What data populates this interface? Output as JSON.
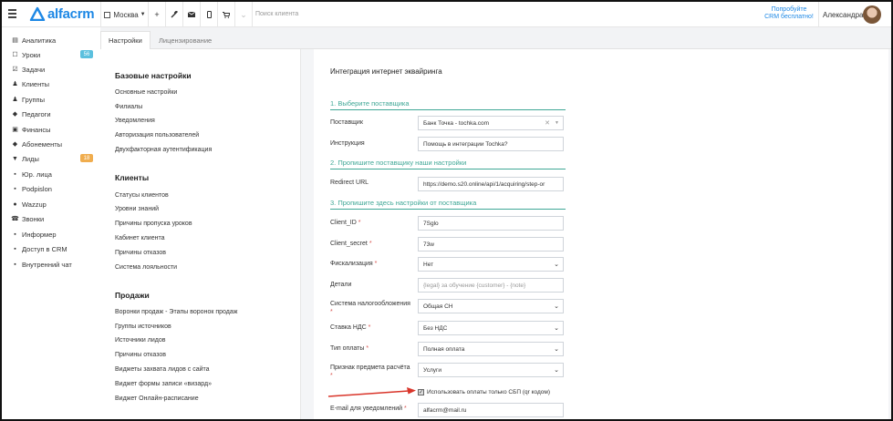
{
  "topbar": {
    "brand": "alfacrm",
    "city": "Москва",
    "search_placeholder": "Поиск клиента",
    "promo_line1": "Попробуйте",
    "promo_line2": "CRM бесплатно!",
    "username": "Александра",
    "icons": [
      "plus-icon",
      "wrench-icon",
      "mail-icon",
      "phone-icon",
      "cart-icon",
      "chevron-down-icon"
    ]
  },
  "sidebar": {
    "items": [
      {
        "label": "Аналитика",
        "icon": "analytics-icon",
        "glyph": "▤"
      },
      {
        "label": "Уроки",
        "icon": "calendar-icon",
        "glyph": "☐",
        "badge": "56"
      },
      {
        "label": "Задачи",
        "icon": "tasks-icon",
        "glyph": "☑"
      },
      {
        "label": "Клиенты",
        "icon": "user-icon",
        "glyph": "👤"
      },
      {
        "label": "Группы",
        "icon": "users-icon",
        "glyph": "👥"
      },
      {
        "label": "Педагоги",
        "icon": "graduation-icon",
        "glyph": "🎓"
      },
      {
        "label": "Финансы",
        "icon": "money-icon",
        "glyph": "▣"
      },
      {
        "label": "Абонементы",
        "icon": "tag-icon",
        "glyph": "◆"
      },
      {
        "label": "Лиды",
        "icon": "funnel-icon",
        "glyph": "⚲",
        "badge": "18"
      },
      {
        "label": "Юр. лица",
        "icon": "briefcase-icon",
        "glyph": "▪"
      },
      {
        "label": "Podpislon",
        "icon": "document-icon",
        "glyph": "▪"
      },
      {
        "label": "Wazzup",
        "icon": "chat-icon",
        "glyph": "●"
      },
      {
        "label": "Звонки",
        "icon": "phone-icon",
        "glyph": "☎"
      },
      {
        "label": "Информер",
        "icon": "informer-icon",
        "glyph": "▪"
      },
      {
        "label": "Доступ в CRM",
        "icon": "lock-icon",
        "glyph": "🔒"
      },
      {
        "label": "Внутренний чат",
        "icon": "message-icon",
        "glyph": "▪"
      }
    ]
  },
  "tabs": [
    {
      "label": "Настройки",
      "active": true
    },
    {
      "label": "Лицензирование",
      "active": false
    }
  ],
  "menu": {
    "sections": [
      {
        "title": "Базовые настройки",
        "links": [
          "Основные настройки",
          "Филиалы",
          "Уведомления",
          "Авторизация пользователей",
          "Двухфакторная аутентификация"
        ]
      },
      {
        "title": "Клиенты",
        "links": [
          "Статусы клиентов",
          "Уровни знаний",
          "Причины пропуска уроков",
          "Кабинет клиента",
          "Причины отказов",
          "Система лояльности"
        ]
      },
      {
        "title": "Продажи",
        "links": [
          "Воронки продаж - Этапы воронок продаж",
          "Группы источников",
          "Источники лидов",
          "Причины отказов",
          "Виджеты захвата лидов с сайта",
          "Виджет формы записи «визард»",
          "Виджет Онлайн-расписание"
        ]
      }
    ]
  },
  "form": {
    "title": "Интеграция интернет эквайринга",
    "section1": "1. Выберите поставщика",
    "section2": "2. Пропишите поставщику наши настройки",
    "section3": "3. Пропишите здесь настройки от поставщика",
    "provider_label": "Поставщик",
    "provider_value": "Банк Точка - tochka.com",
    "instruction_label": "Инструкция",
    "instruction_value": "Помощь в интеграции Tochka?",
    "redirect_label": "Redirect URL",
    "redirect_value": "https://demo.s20.online/api/1/acquiring/step-or",
    "client_id_label": "Client_ID",
    "client_id_value": "7Sglo",
    "client_secret_label": "Client_secret",
    "client_secret_value": "73w",
    "fiscal_label": "Фискализация",
    "fiscal_value": "Нет",
    "details_label": "Детали",
    "details_placeholder": "{legal} за обучение {customer} - {note}",
    "tax_label": "Система налогообложения",
    "tax_value": "Общая СН",
    "vat_label": "Ставка НДС",
    "vat_value": "Без НДС",
    "paytype_label": "Тип оплаты",
    "paytype_value": "Полная оплата",
    "subject_label": "Признак предмета расчёта",
    "subject_value": "Услуги",
    "sbp_checkbox_label": "Использовать оплаты только СБП (qr кодом)",
    "email_label": "E-mail для уведомлений",
    "email_value": "alfacrm@mail.ru",
    "required_mark": "*"
  },
  "colors": {
    "accent": "#1e88e5",
    "section": "#3fa796",
    "arrow": "#d9352a"
  }
}
